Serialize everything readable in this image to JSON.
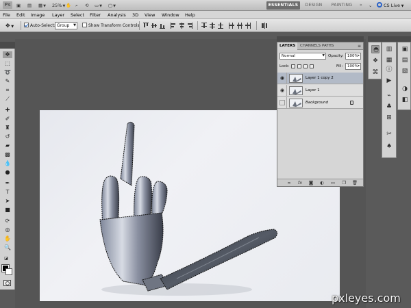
{
  "appbar": {
    "logo": "Ps",
    "zoom": "25%",
    "workspaces": {
      "essentials": "ESSENTIALS",
      "design": "DESIGN",
      "painting": "PAINTING",
      "more": "»"
    },
    "cs_live": "CS Live"
  },
  "menu": [
    "File",
    "Edit",
    "Image",
    "Layer",
    "Select",
    "Filter",
    "Analysis",
    "3D",
    "View",
    "Window",
    "Help"
  ],
  "options": {
    "auto_select_label": "Auto-Select:",
    "auto_select_checked": true,
    "auto_select_mode": "Group",
    "show_transform_label": "Show Transform Controls",
    "show_transform_checked": false
  },
  "layers_panel": {
    "tabs": [
      "LAYERS",
      "CHANNELS",
      "PATHS"
    ],
    "blend_mode": "Normal",
    "opacity_label": "Opacity:",
    "opacity": "100%",
    "lock_label": "Lock:",
    "fill_label": "Fill:",
    "fill": "100%",
    "layers": [
      {
        "name": "Layer 1 copy 2",
        "visible": true,
        "selected": true
      },
      {
        "name": "Layer 1",
        "visible": true,
        "selected": false
      },
      {
        "name": "Background",
        "visible": false,
        "selected": false,
        "locked": true
      }
    ]
  },
  "watermark": "pxleyes.com",
  "colors": {
    "accent": "#6d6d6d",
    "selected_layer": "#b2bac7",
    "foreground": "#000000",
    "background": "#ffffff"
  }
}
